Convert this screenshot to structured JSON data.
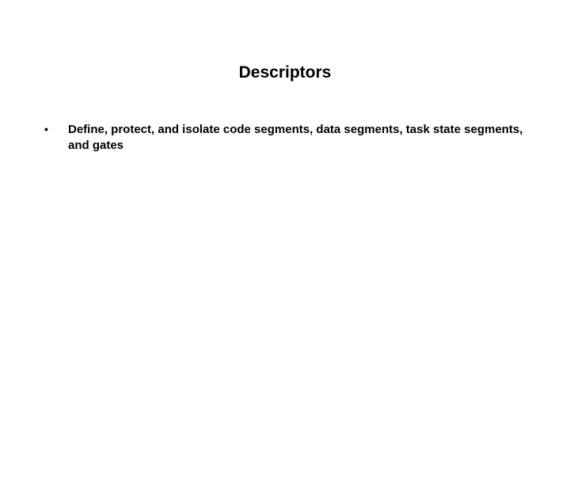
{
  "slide": {
    "title": "Descriptors",
    "bullets": [
      {
        "text": "Define, protect, and isolate code segments, data segments, task state segments, and gates"
      }
    ]
  }
}
